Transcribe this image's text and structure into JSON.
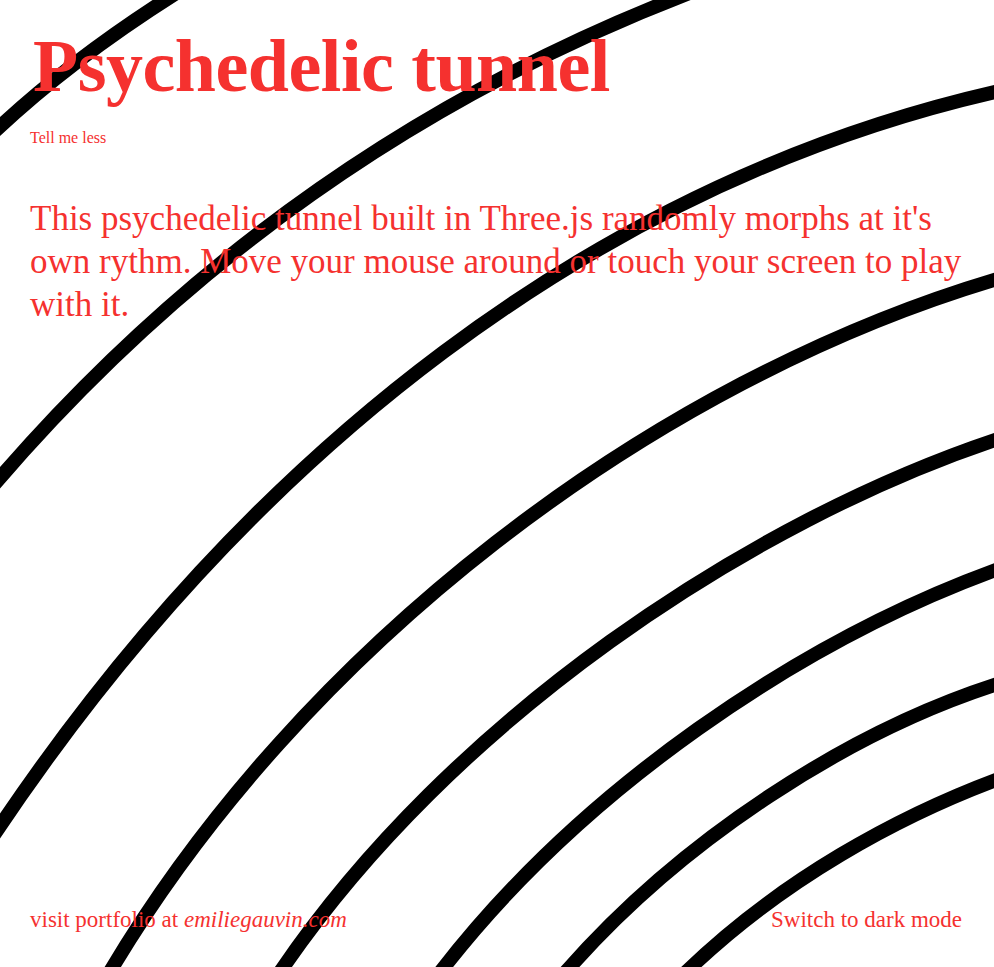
{
  "header": {
    "title": "Psychedelic tunnel",
    "toggle": "Tell me less"
  },
  "description": "This psychedelic tunnel built in Three.js randomly morphs at it's own rythm. Move your mouse around or touch your screen to play with it.",
  "footer": {
    "portfolio_prefix": "visit portfolio at ",
    "portfolio_link": "emiliegauvin.com",
    "theme_switch": "Switch to dark mode"
  }
}
